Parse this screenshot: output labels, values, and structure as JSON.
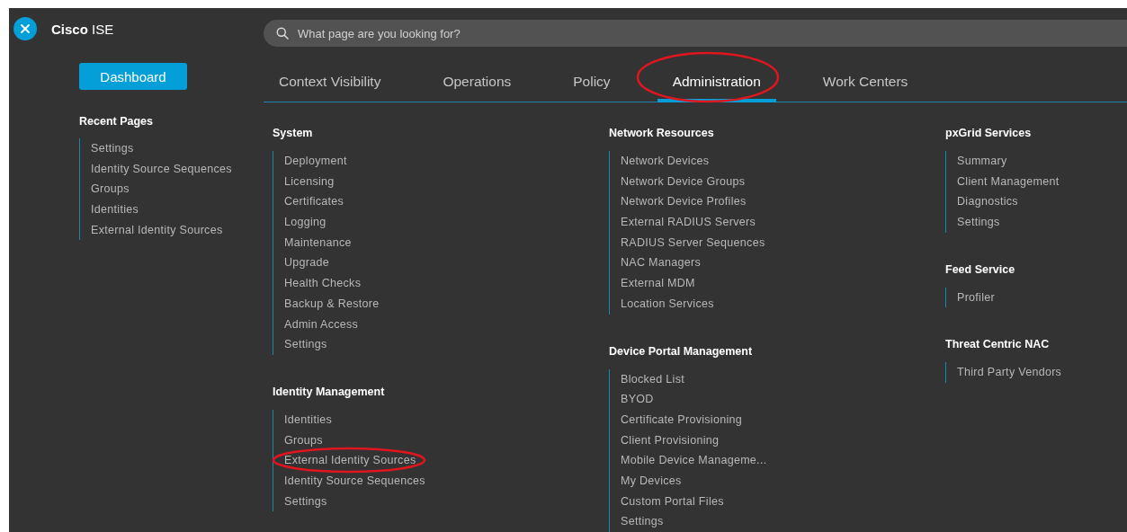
{
  "brand": {
    "bold": "Cisco",
    "rest": "ISE"
  },
  "search": {
    "placeholder": "What page are you looking for?"
  },
  "dashboard_button": "Dashboard",
  "recent_pages": {
    "title": "Recent Pages",
    "items": [
      "Settings",
      "Identity Source Sequences",
      "Groups",
      "Identities",
      "External Identity Sources"
    ]
  },
  "tabs": [
    {
      "label": "Context Visibility",
      "selected": false,
      "circled": false
    },
    {
      "label": "Operations",
      "selected": false,
      "circled": false
    },
    {
      "label": "Policy",
      "selected": false,
      "circled": false
    },
    {
      "label": "Administration",
      "selected": true,
      "circled": true
    },
    {
      "label": "Work Centers",
      "selected": false,
      "circled": false
    }
  ],
  "menu_columns": [
    [
      {
        "title": "System",
        "items": [
          {
            "label": "Deployment",
            "circled": false
          },
          {
            "label": "Licensing",
            "circled": false
          },
          {
            "label": "Certificates",
            "circled": false
          },
          {
            "label": "Logging",
            "circled": false
          },
          {
            "label": "Maintenance",
            "circled": false
          },
          {
            "label": "Upgrade",
            "circled": false
          },
          {
            "label": "Health Checks",
            "circled": false
          },
          {
            "label": "Backup & Restore",
            "circled": false
          },
          {
            "label": "Admin Access",
            "circled": false
          },
          {
            "label": "Settings",
            "circled": false
          }
        ]
      },
      {
        "title": "Identity Management",
        "items": [
          {
            "label": "Identities",
            "circled": false
          },
          {
            "label": "Groups",
            "circled": false
          },
          {
            "label": "External Identity Sources",
            "circled": true
          },
          {
            "label": "Identity Source Sequences",
            "circled": false
          },
          {
            "label": "Settings",
            "circled": false
          }
        ]
      }
    ],
    [
      {
        "title": "Network Resources",
        "items": [
          {
            "label": "Network Devices",
            "circled": false
          },
          {
            "label": "Network Device Groups",
            "circled": false
          },
          {
            "label": "Network Device Profiles",
            "circled": false
          },
          {
            "label": "External RADIUS Servers",
            "circled": false
          },
          {
            "label": "RADIUS Server Sequences",
            "circled": false
          },
          {
            "label": "NAC Managers",
            "circled": false
          },
          {
            "label": "External MDM",
            "circled": false
          },
          {
            "label": "Location Services",
            "circled": false
          }
        ]
      },
      {
        "title": "Device Portal Management",
        "items": [
          {
            "label": "Blocked List",
            "circled": false
          },
          {
            "label": "BYOD",
            "circled": false
          },
          {
            "label": "Certificate Provisioning",
            "circled": false
          },
          {
            "label": "Client Provisioning",
            "circled": false
          },
          {
            "label": "Mobile Device Manageme...",
            "circled": false
          },
          {
            "label": "My Devices",
            "circled": false
          },
          {
            "label": "Custom Portal Files",
            "circled": false
          },
          {
            "label": "Settings",
            "circled": false
          }
        ]
      }
    ],
    [
      {
        "title": "pxGrid Services",
        "items": [
          {
            "label": "Summary",
            "circled": false
          },
          {
            "label": "Client Management",
            "circled": false
          },
          {
            "label": "Diagnostics",
            "circled": false
          },
          {
            "label": "Settings",
            "circled": false
          }
        ]
      },
      {
        "title": "Feed Service",
        "items": [
          {
            "label": "Profiler",
            "circled": false
          }
        ]
      },
      {
        "title": "Threat Centric NAC",
        "items": [
          {
            "label": "Third Party Vendors",
            "circled": false
          }
        ]
      }
    ]
  ]
}
